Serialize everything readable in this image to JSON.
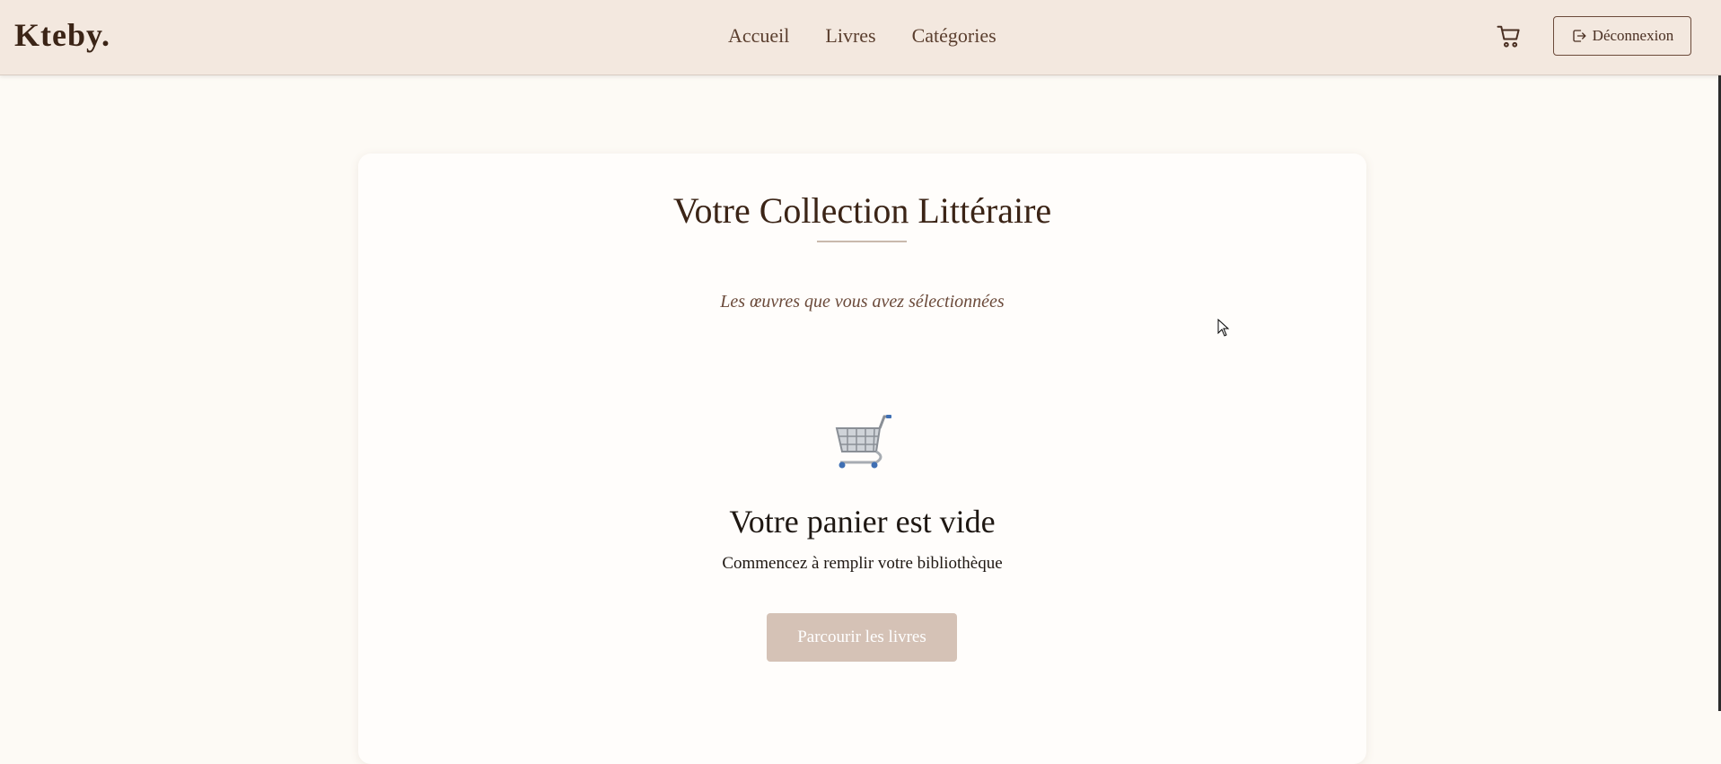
{
  "navbar": {
    "brand": "Kteby.",
    "links": [
      "Accueil",
      "Livres",
      "Catégories"
    ],
    "cart_icon": "cart-icon",
    "logout_icon": "logout-icon",
    "logout_label": "Déconnexion"
  },
  "main": {
    "title": "Votre Collection Littéraire",
    "subtitle": "Les œuvres que vous avez sélectionnées",
    "empty_icon": "shopping-cart-icon",
    "empty_title": "Votre panier est vide",
    "empty_text": "Commencez à remplir votre bibliothèque",
    "browse_label": "Parcourir les livres"
  },
  "colors": {
    "navbar_bg": "#f3e8df",
    "page_bg": "#fdfaf5",
    "brand_text": "#3b2416",
    "button_bg": "#d5c2b6"
  }
}
